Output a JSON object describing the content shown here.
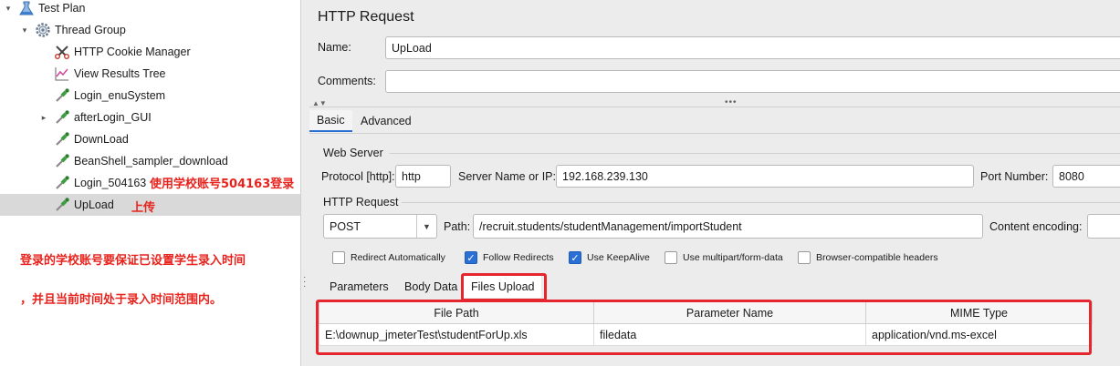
{
  "tree": {
    "items": [
      {
        "label": "Test Plan",
        "icon": "flask-icon",
        "toggle": "▾"
      },
      {
        "label": "Thread Group",
        "icon": "gear-icon",
        "toggle": "▾"
      },
      {
        "label": "HTTP Cookie Manager",
        "icon": "scissors-icon"
      },
      {
        "label": "View Results Tree",
        "icon": "graph-icon"
      },
      {
        "label": "Login_enuSystem",
        "icon": "pipette-icon"
      },
      {
        "label": "afterLogin_GUI",
        "icon": "pipette-icon",
        "toggle": "▸"
      },
      {
        "label": "DownLoad",
        "icon": "pipette-icon"
      },
      {
        "label": "BeanShell_sampler_download",
        "icon": "pipette-icon"
      },
      {
        "label": "Login_504163",
        "icon": "pipette-icon"
      },
      {
        "label": "UpLoad",
        "icon": "pipette-icon"
      }
    ],
    "annotations": {
      "login_note": "使用学校账号504163登录",
      "upload_note": "上传",
      "note_line1": "登录的学校账号要保证已设置学生录入时间",
      "note_line2": "，并且当前时间处于录入时间范围内。"
    }
  },
  "panel": {
    "title": "HTTP Request",
    "name_label": "Name:",
    "name_value": "UpLoad",
    "comments_label": "Comments:",
    "comments_value": "",
    "tabs": [
      "Basic",
      "Advanced"
    ],
    "web_server": {
      "section": "Web Server",
      "protocol_label": "Protocol [http]:",
      "protocol_value": "http",
      "server_label": "Server Name or IP:",
      "server_value": "192.168.239.130",
      "port_label": "Port Number:",
      "port_value": "8080"
    },
    "http_request": {
      "section": "HTTP Request",
      "method": "POST",
      "path_label": "Path:",
      "path_value": "/recruit.students/studentManagement/importStudent",
      "encoding_label": "Content encoding:",
      "encoding_value": ""
    },
    "options": [
      {
        "label": "Redirect Automatically",
        "checked": false
      },
      {
        "label": "Follow Redirects",
        "checked": true
      },
      {
        "label": "Use KeepAlive",
        "checked": true
      },
      {
        "label": "Use multipart/form-data",
        "checked": false
      },
      {
        "label": "Browser-compatible headers",
        "checked": false
      }
    ],
    "sub_tabs": [
      "Parameters",
      "Body Data",
      "Files Upload"
    ],
    "files_table": {
      "headers": [
        "File Path",
        "Parameter Name",
        "MIME Type"
      ],
      "rows": [
        [
          "E:\\downup_jmeterTest\\studentForUp.xls",
          "filedata",
          "application/vnd.ms-excel"
        ]
      ]
    }
  },
  "colors": {
    "annotation_red": "#e8231d",
    "highlight_box": "#e5262e",
    "checkbox_on": "#2a6fd6"
  }
}
